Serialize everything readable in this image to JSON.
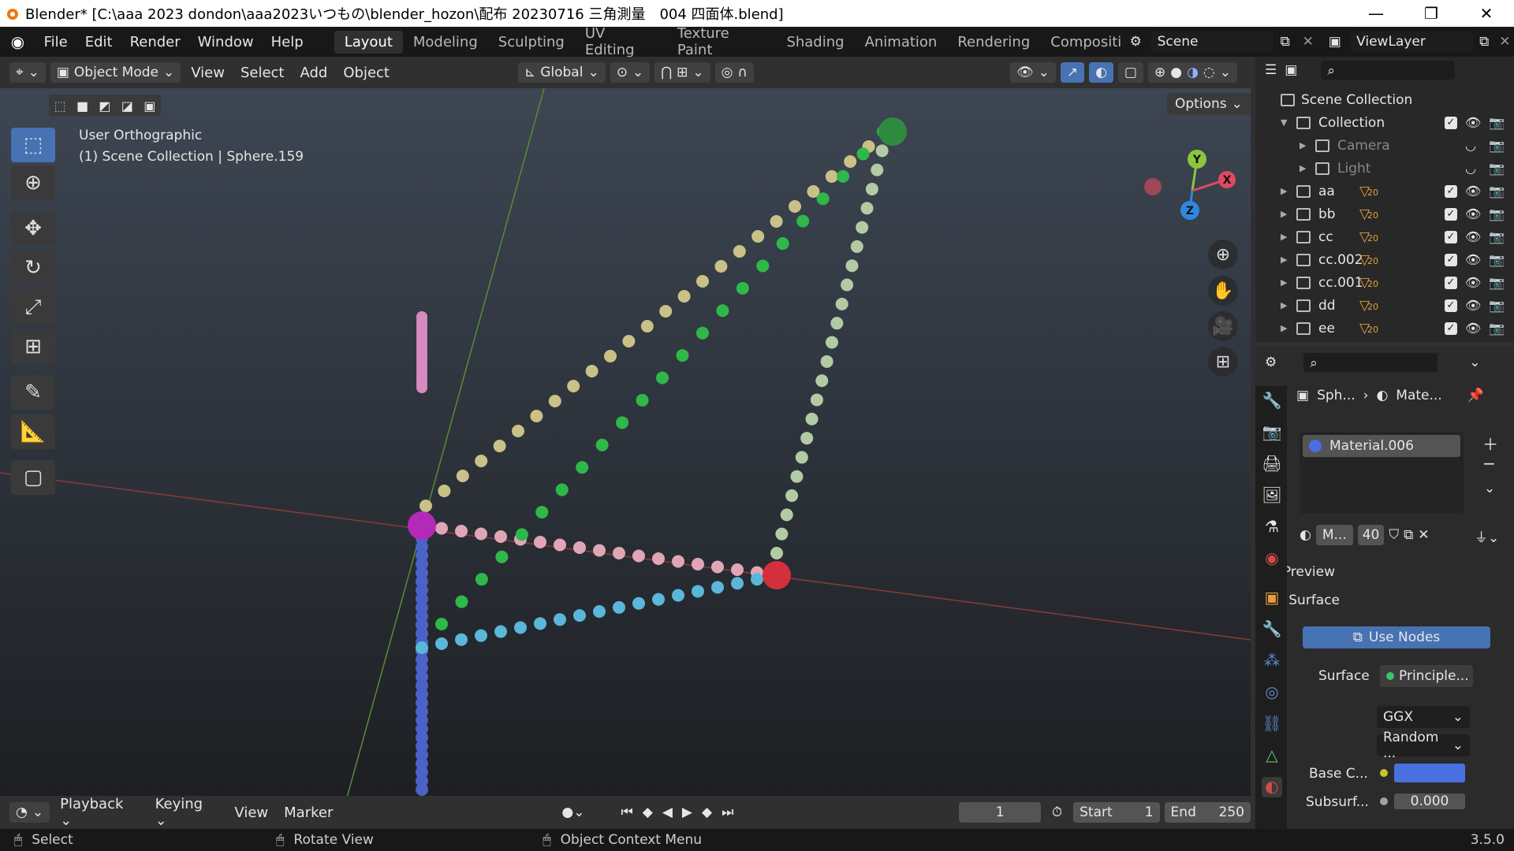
{
  "window": {
    "title": "Blender* [C:\\aaa 2023 dondon\\aaa2023いつもの\\blender_hozon\\配布 20230716 三角測量　004 四面体.blend]",
    "minimize": "—",
    "restore": "❐",
    "close": "✕"
  },
  "menu": [
    "File",
    "Edit",
    "Render",
    "Window",
    "Help"
  ],
  "workspaces": [
    "Layout",
    "Modeling",
    "Sculpting",
    "UV Editing",
    "Texture Paint",
    "Shading",
    "Animation",
    "Rendering",
    "Compositin"
  ],
  "scene_name": "Scene",
  "view_layer": "ViewLayer",
  "viewport_header": {
    "mode": "Object Mode",
    "menus": [
      "View",
      "Select",
      "Add",
      "Object"
    ],
    "transform_orientation": "Global",
    "options": "Options"
  },
  "viewport": {
    "view_name": "User Orthographic",
    "context": "(1) Scene Collection | Sphere.159",
    "gizmo": {
      "y": "Y",
      "x": "X",
      "z": "Z"
    }
  },
  "outliner": {
    "root": "Scene Collection",
    "rows": [
      {
        "label": "Collection",
        "indent": 1,
        "count": ""
      },
      {
        "label": "Camera",
        "indent": 2,
        "count": ""
      },
      {
        "label": "Light",
        "indent": 2,
        "count": ""
      },
      {
        "label": "aa",
        "indent": 1,
        "count": "20"
      },
      {
        "label": "bb",
        "indent": 1,
        "count": "20"
      },
      {
        "label": "cc",
        "indent": 1,
        "count": "20"
      },
      {
        "label": "cc.002",
        "indent": 1,
        "count": "20"
      },
      {
        "label": "cc.001",
        "indent": 1,
        "count": "20"
      },
      {
        "label": "dd",
        "indent": 1,
        "count": "20"
      },
      {
        "label": "ee",
        "indent": 1,
        "count": "20"
      }
    ]
  },
  "properties": {
    "breadcrumb_object": "Sph...",
    "breadcrumb_material": "Mate...",
    "material_slot": "Material.006",
    "material_short": "M...",
    "users": "40",
    "panels": {
      "preview": "Preview",
      "surface": "Surface"
    },
    "use_nodes": "Use Nodes",
    "surface_label": "Surface",
    "surface_value": "Principle...",
    "distribution": "GGX",
    "subsurface_method": "Random ...",
    "base_color_label": "Base C...",
    "base_color": "#4a6fe0",
    "subsurface_label": "Subsurf...",
    "subsurface_value": "0.000"
  },
  "timeline": {
    "menus": [
      "Playback",
      "Keying",
      "View",
      "Marker"
    ],
    "current_frame": "1",
    "start_label": "Start",
    "start": "1",
    "end_label": "End",
    "end": "250"
  },
  "statusbar": {
    "select": "Select",
    "rotate": "Rotate View",
    "context_menu": "Object Context Menu",
    "version": "3.5.0"
  }
}
